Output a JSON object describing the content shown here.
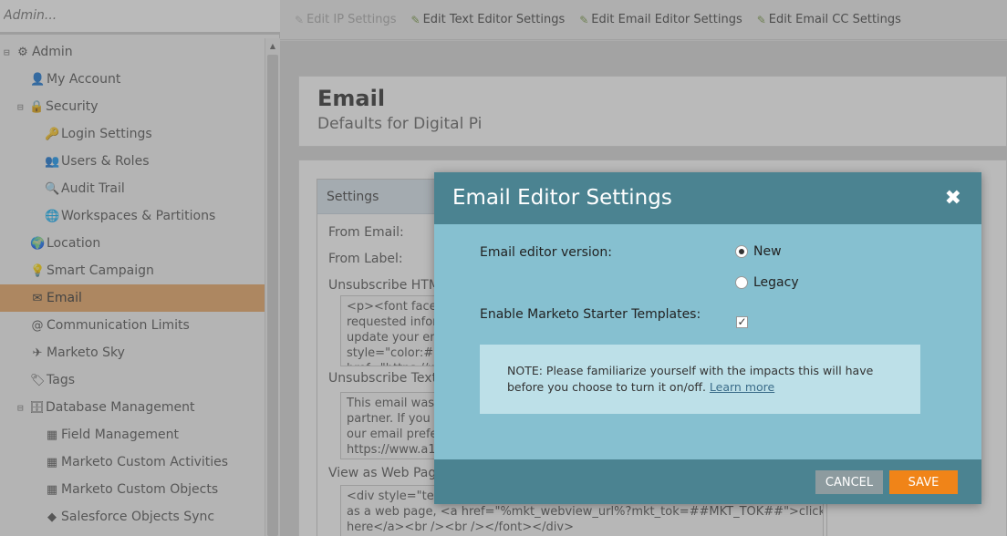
{
  "sidebar": {
    "search_placeholder": "Admin...",
    "items": [
      {
        "toggle": "⊟",
        "icon": "⚙",
        "label": "Admin",
        "level": "lvl0"
      },
      {
        "toggle": "",
        "icon": "👤",
        "label": "My Account",
        "level": "lvl1"
      },
      {
        "toggle": "⊟",
        "icon": "🔒",
        "label": "Security",
        "level": "lvl1t"
      },
      {
        "toggle": "",
        "icon": "🔑",
        "label": "Login Settings",
        "level": "lvl2"
      },
      {
        "toggle": "",
        "icon": "👥",
        "label": "Users & Roles",
        "level": "lvl2"
      },
      {
        "toggle": "",
        "icon": "🔍",
        "label": "Audit Trail",
        "level": "lvl2"
      },
      {
        "toggle": "",
        "icon": "🌐",
        "label": "Workspaces & Partitions",
        "level": "lvl2"
      },
      {
        "toggle": "",
        "icon": "🌍",
        "label": "Location",
        "level": "lvl1"
      },
      {
        "toggle": "",
        "icon": "💡",
        "label": "Smart Campaign",
        "level": "lvl1"
      },
      {
        "toggle": "",
        "icon": "✉",
        "label": "Email",
        "level": "lvl1",
        "active": true
      },
      {
        "toggle": "",
        "icon": "@",
        "label": "Communication Limits",
        "level": "lvl1"
      },
      {
        "toggle": "",
        "icon": "✈",
        "label": "Marketo Sky",
        "level": "lvl1"
      },
      {
        "toggle": "",
        "icon": "🏷",
        "label": "Tags",
        "level": "lvl1"
      },
      {
        "toggle": "⊟",
        "icon": "🗄",
        "label": "Database Management",
        "level": "lvl1t"
      },
      {
        "toggle": "",
        "icon": "▦",
        "label": "Field Management",
        "level": "lvl2"
      },
      {
        "toggle": "",
        "icon": "▦",
        "label": "Marketo Custom Activities",
        "level": "lvl2"
      },
      {
        "toggle": "",
        "icon": "▦",
        "label": "Marketo Custom Objects",
        "level": "lvl2"
      },
      {
        "toggle": "",
        "icon": "◆",
        "label": "Salesforce Objects Sync",
        "level": "lvl2"
      }
    ]
  },
  "toolbar": {
    "items": [
      {
        "label": "Edit IP Settings",
        "disabled": true
      },
      {
        "label": "Edit Text Editor Settings",
        "disabled": false
      },
      {
        "label": "Edit Email Editor Settings",
        "disabled": false
      },
      {
        "label": "Edit Email CC Settings",
        "disabled": false
      }
    ]
  },
  "page": {
    "title": "Email",
    "subtitle": "Defaults for Digital Pi",
    "settings_header": "Settings",
    "from_email_label": "From Email:",
    "from_label_label": "From Label:",
    "unsubscribe_html_label": "Unsubscribe HTML:",
    "unsubscribe_html_text": "<p><font face=\nrequested inform\nupdate your ema\nstyle=\"color:#00\nhref=\"https://w",
    "unsubscribe_text_label": "Unsubscribe Text:",
    "unsubscribe_text_value": "This email was s\npartner. If you w\nour email prefer\nhttps://www.a1",
    "web_page_label": "View as Web Page:",
    "web_page_value": "<div style=\"text\nas a web page, <a href=\"%mkt_webview_url%?mkt_tok=##MKT_TOK##\">click\nhere</a><br /><br /></font></div>"
  },
  "dialog": {
    "title": "Email Editor Settings",
    "close_glyph": "✖",
    "version_label": "Email editor version:",
    "option_new": "New",
    "option_legacy": "Legacy",
    "selected_version": "New",
    "starter_label": "Enable Marketo Starter Templates:",
    "starter_checked": true,
    "check_glyph": "✓",
    "note_text": "NOTE:  Please familiarize yourself with the impacts this will have before you choose to turn it on/off.",
    "learn_more": "Learn more",
    "cancel_label": "CANCEL",
    "save_label": "SAVE"
  },
  "colors": {
    "accent_active": "#e9a866",
    "dialog_header": "#4b8391",
    "dialog_body": "#86c0d0",
    "save_button": "#f08418",
    "cancel_button": "#8d9b9f"
  }
}
